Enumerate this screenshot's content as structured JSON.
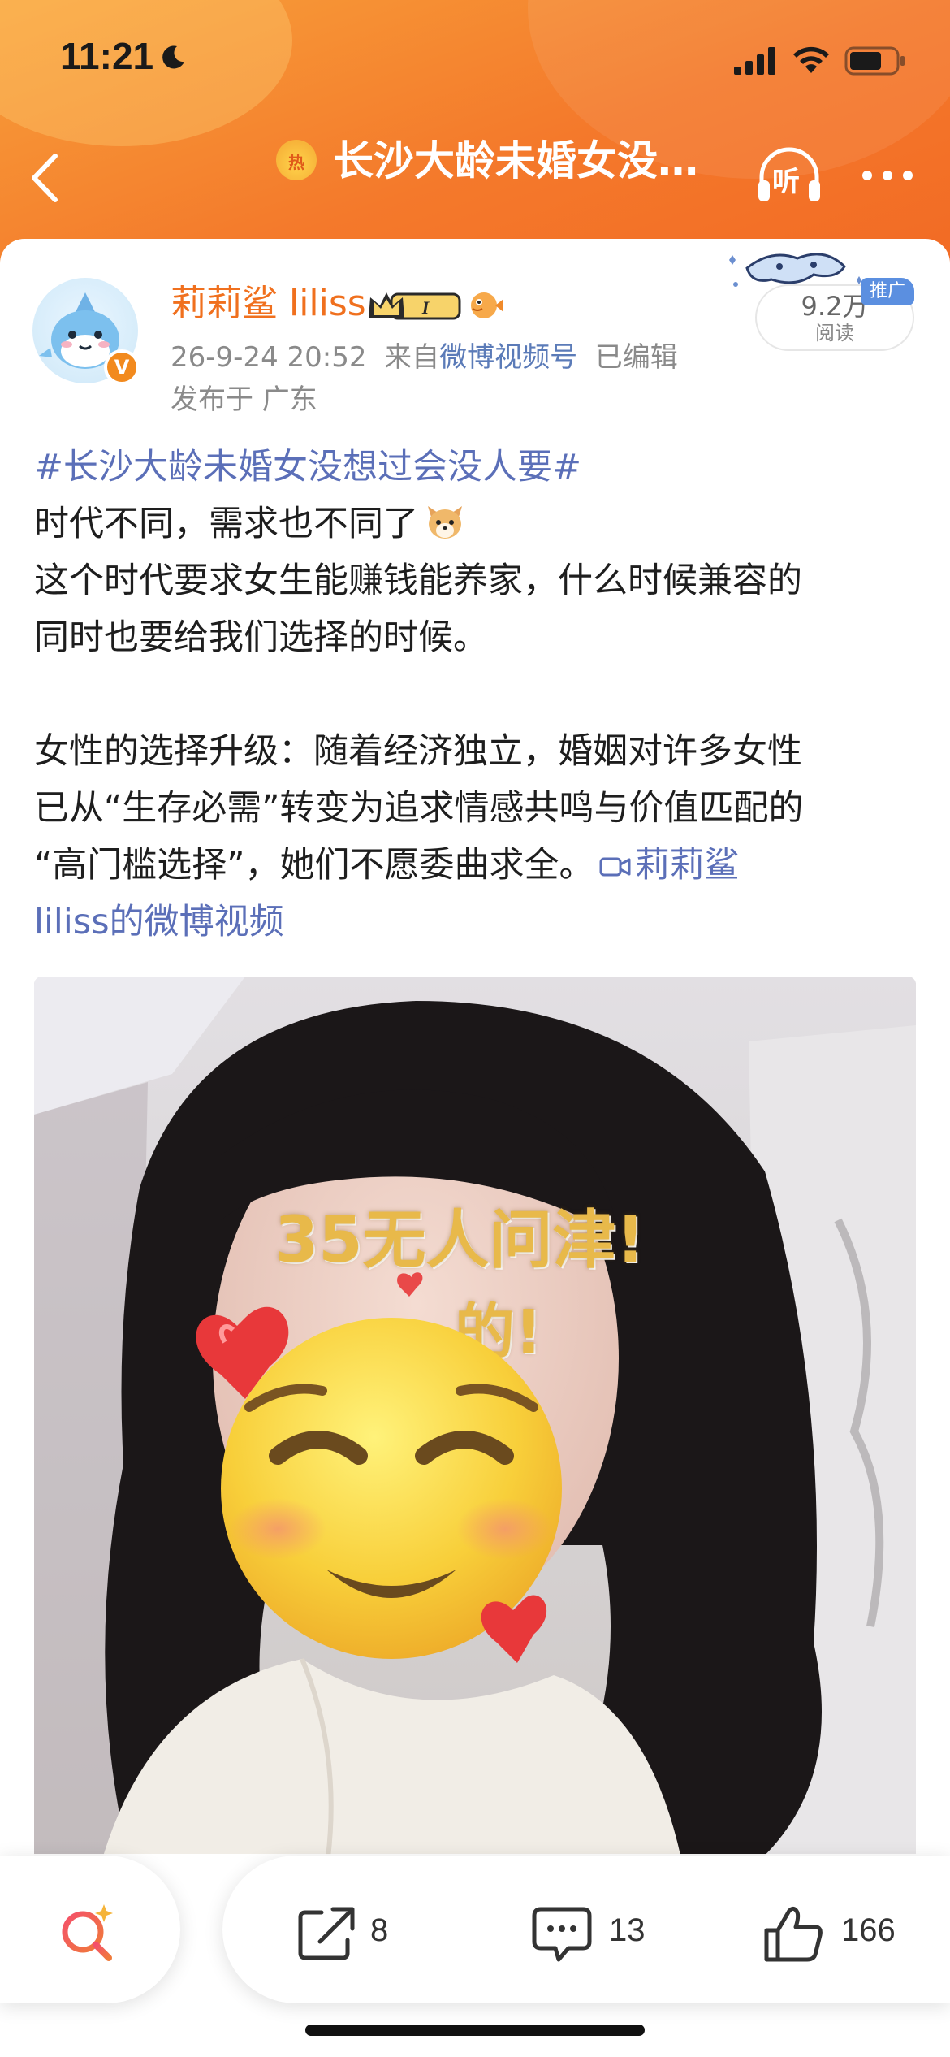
{
  "status_bar": {
    "time": "11:21"
  },
  "nav": {
    "hot_label": "热",
    "title": "长沙大龄未婚女没…",
    "listen_label": "听"
  },
  "post": {
    "username": "莉莉鲨 liliss",
    "vip_level": "I",
    "timestamp": "26-9-24 20:52",
    "source_prefix": "来自",
    "source": "微博视频号",
    "edited": "已编辑",
    "location": "发布于 广东",
    "verified_mark": "V",
    "read_count": "9.2万",
    "read_label": "阅读",
    "ad_tag": "推广",
    "hashtag": "#长沙大龄未婚女没想过会没人要#",
    "line1": "时代不同，需求也不同了",
    "line2": "这个时代要求女生能赚钱能养家，什么时候兼容的",
    "line3": "同时也要给我们选择的时候。",
    "line4": "女性的选择升级：随着经济独立，婚姻对许多女性",
    "line5": "已从“生存必需”转变为追求情感共鸣与价值匹配的",
    "line6": "“高门槛选择”，她们不愿委曲求全。",
    "video_link_1": "莉莉鲨",
    "video_link_2": "liliss的微博视频"
  },
  "video": {
    "overlay_line1": "35无人问津!",
    "overlay_line2": "的!"
  },
  "toolbar": {
    "share_count": "8",
    "comment_count": "13",
    "like_count": "166"
  },
  "colors": {
    "header_orange": "#f4792b",
    "username_orange": "#f0701e",
    "link_blue": "#5b6fb8"
  }
}
